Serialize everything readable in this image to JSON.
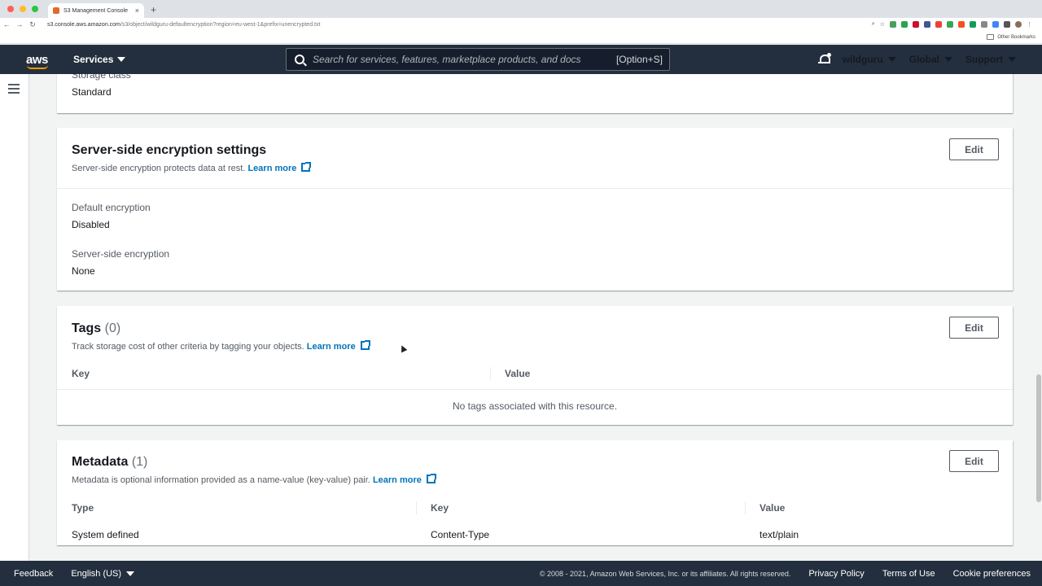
{
  "browser": {
    "tab_title": "S3 Management Console",
    "new_tab": "+",
    "url_host": "s3.console.aws.amazon.com",
    "url_path": "/s3/object/wildguru-defaultencryption?region=eu-west-1&prefix=unencrypted.txt",
    "bookmarks_label": "Other Bookmarks"
  },
  "nav": {
    "logo": "aws",
    "services": "Services",
    "search_placeholder": "Search for services, features, marketplace products, and docs",
    "search_shortcut": "[Option+S]",
    "account": "wildguru",
    "region": "Global",
    "support": "Support"
  },
  "storage_class": {
    "label": "Storage class",
    "value": "Standard"
  },
  "encryption": {
    "title": "Server-side encryption settings",
    "description": "Server-side encryption protects data at rest.",
    "learn_more": "Learn more",
    "edit": "Edit",
    "default_label": "Default encryption",
    "default_value": "Disabled",
    "sse_label": "Server-side encryption",
    "sse_value": "None"
  },
  "tags": {
    "title": "Tags",
    "count": "(0)",
    "description": "Track storage cost of other criteria by tagging your objects.",
    "learn_more": "Learn more",
    "edit": "Edit",
    "columns": [
      "Key",
      "Value"
    ],
    "empty": "No tags associated with this resource."
  },
  "metadata": {
    "title": "Metadata",
    "count": "(1)",
    "description": "Metadata is optional information provided as a name-value (key-value) pair.",
    "learn_more": "Learn more",
    "edit": "Edit",
    "columns": [
      "Type",
      "Key",
      "Value"
    ],
    "rows": [
      {
        "type": "System defined",
        "key": "Content-Type",
        "value": "text/plain"
      }
    ]
  },
  "footer": {
    "feedback": "Feedback",
    "language": "English (US)",
    "copyright": "© 2008 - 2021, Amazon Web Services, Inc. or its affiliates. All rights reserved.",
    "privacy": "Privacy Policy",
    "terms": "Terms of Use",
    "cookies": "Cookie preferences"
  },
  "colors": {
    "nav_bg": "#232f3e",
    "link": "#0073bb",
    "accent": "#ff9900"
  }
}
